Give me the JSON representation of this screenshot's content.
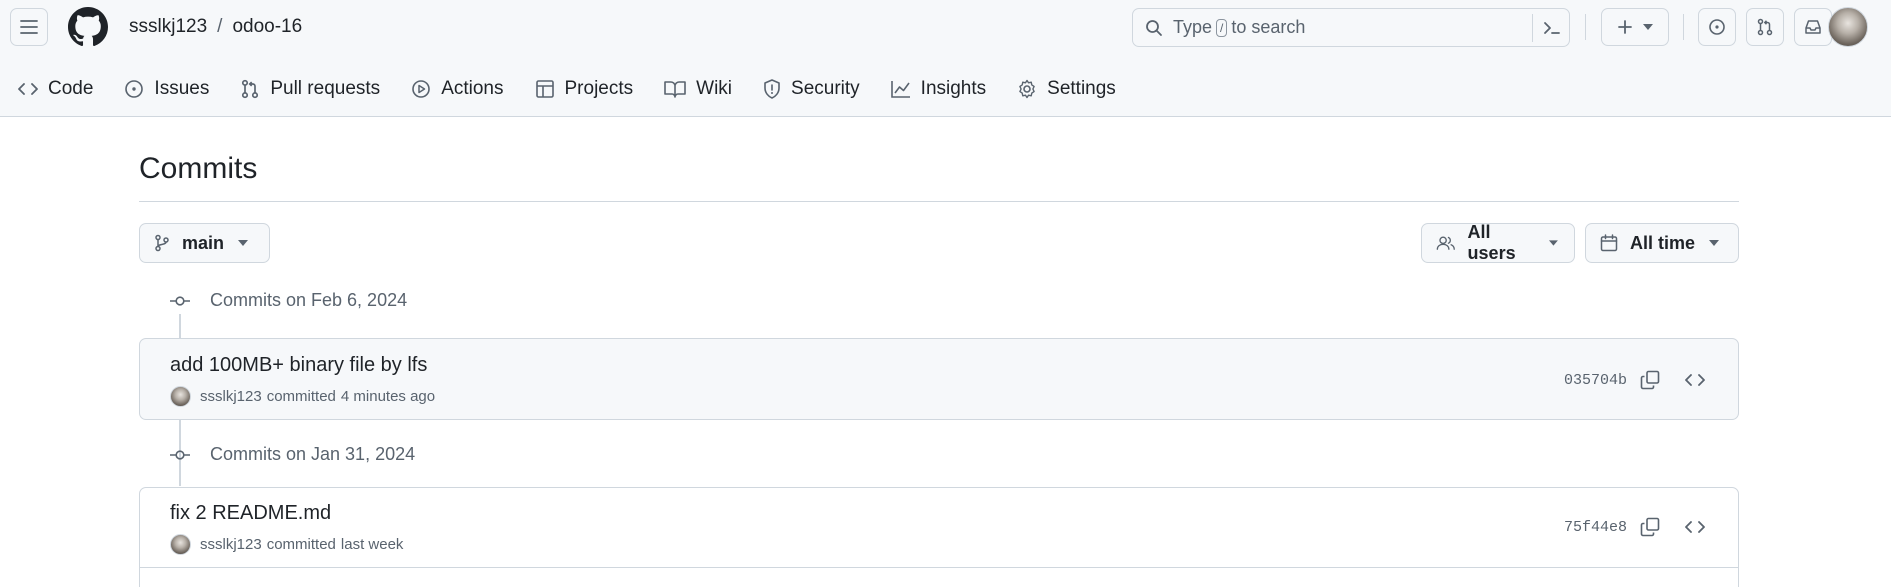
{
  "header": {
    "owner": "ssslkj123",
    "separator": "/",
    "repo": "odoo-16",
    "search": {
      "prefix": "Type",
      "key": "/",
      "suffix": "to search"
    },
    "icons": [
      "hamburger-icon",
      "github-logo-icon",
      "search-icon",
      "command-palette-icon",
      "plus-icon",
      "issues-icon",
      "pull-requests-icon",
      "inbox-icon"
    ]
  },
  "tabs": [
    {
      "label": "Code",
      "icon": "code-icon"
    },
    {
      "label": "Issues",
      "icon": "issue-icon"
    },
    {
      "label": "Pull requests",
      "icon": "pull-request-icon"
    },
    {
      "label": "Actions",
      "icon": "play-icon"
    },
    {
      "label": "Projects",
      "icon": "table-icon"
    },
    {
      "label": "Wiki",
      "icon": "book-icon"
    },
    {
      "label": "Security",
      "icon": "shield-icon"
    },
    {
      "label": "Insights",
      "icon": "graph-icon"
    },
    {
      "label": "Settings",
      "icon": "gear-icon"
    }
  ],
  "page": {
    "title": "Commits",
    "branch_label": "main",
    "users_label": "All users",
    "time_label": "All time"
  },
  "groups": [
    {
      "heading": "Commits on Feb 6, 2024",
      "commits": [
        {
          "message": "add 100MB+ binary file by lfs",
          "author": "ssslkj123",
          "verb": "committed",
          "when": "4 minutes ago",
          "sha": "035704b"
        }
      ]
    },
    {
      "heading": "Commits on Jan 31, 2024",
      "commits": [
        {
          "message": "fix 2 README.md",
          "author": "ssslkj123",
          "verb": "committed",
          "when": "last week",
          "sha": "75f44e8"
        }
      ]
    }
  ],
  "colors": {
    "border": "#d0d7de",
    "muted": "#59636e",
    "fg": "#1f2328",
    "subtle_bg": "#f6f8fa"
  }
}
